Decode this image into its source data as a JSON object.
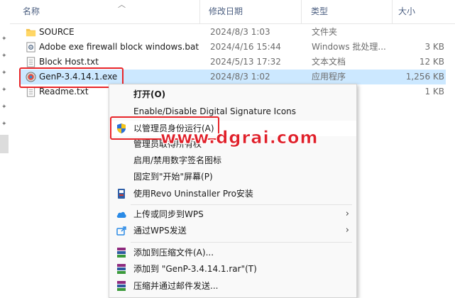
{
  "header": {
    "name": "名称",
    "date": "修改日期",
    "type": "类型",
    "size": "大小"
  },
  "files": [
    {
      "name": "SOURCE",
      "date": "2024/8/3 1:03",
      "type": "文件夹",
      "size": "",
      "icon": "folder-icon"
    },
    {
      "name": "Adobe exe firewall block windows.bat",
      "date": "2024/4/16 15:44",
      "type": "Windows 批处理...",
      "size": "3 KB",
      "icon": "batch-file-icon"
    },
    {
      "name": "Block Host.txt",
      "date": "2024/5/13 17:32",
      "type": "文本文档",
      "size": "12 KB",
      "icon": "text-file-icon"
    },
    {
      "name": "GenP-3.4.14.1.exe",
      "date": "2024/8/3 1:02",
      "type": "应用程序",
      "size": "1,256 KB",
      "icon": "exe-app-icon"
    },
    {
      "name": "Readme.txt",
      "date": "",
      "type": "",
      "size": "1 KB",
      "icon": "text-file-icon"
    }
  ],
  "menu": {
    "open": "打开(O)",
    "signature": "Enable/Disable Digital Signature Icons",
    "run_admin": "以管理员身份运行(A)",
    "take_ownership": "管理员取得所有权",
    "toggle_signature": "启用/禁用数字签名图标",
    "pin_start": "固定到\"开始\"屏幕(P)",
    "revo": "使用Revo Uninstaller Pro安装",
    "wps_upload": "上传或同步到WPS",
    "wps_send": "通过WPS发送",
    "add_archive": "添加到压缩文件(A)...",
    "add_rar": "添加到 \"GenP-3.4.14.1.rar\"(T)",
    "compress_email": "压缩并通过邮件发送..."
  },
  "watermark": "www.dgrai.com",
  "colors": {
    "selection": "#cce8ff",
    "highlight_border": "#e8262a",
    "header_text": "#4d6082"
  }
}
